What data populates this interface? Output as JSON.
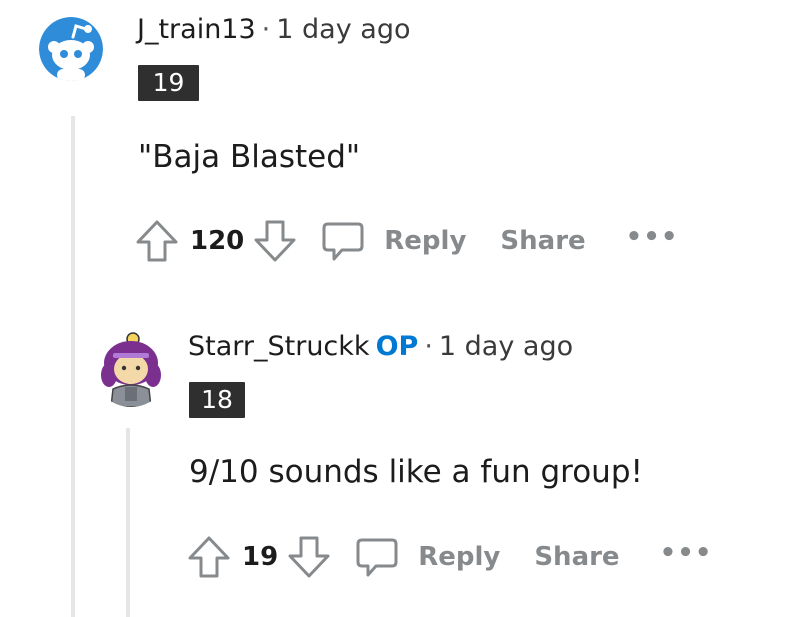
{
  "comments": [
    {
      "username": "J_train13",
      "separator": "·",
      "time": "1 day ago",
      "flair": "19",
      "body": "\"Baja Blasted\"",
      "votes": "120",
      "reply_label": "Reply",
      "share_label": "Share",
      "more_label": "•••",
      "avatar_icon": "snoo-avatar-icon"
    },
    {
      "username": "Starr_Struckk",
      "op_badge": "OP",
      "separator": "·",
      "time": "1 day ago",
      "flair": "18",
      "body": "9/10 sounds like a fun group!",
      "votes": "19",
      "reply_label": "Reply",
      "share_label": "Share",
      "more_label": "•••",
      "avatar_icon": "custom-character-avatar-icon"
    }
  ],
  "colors": {
    "op": "#0079d3",
    "muted": "#878a8c",
    "flair_bg": "#2f2f2f",
    "thread_line": "#e6e6e6",
    "avatar_blue": "#2f8cd8"
  }
}
